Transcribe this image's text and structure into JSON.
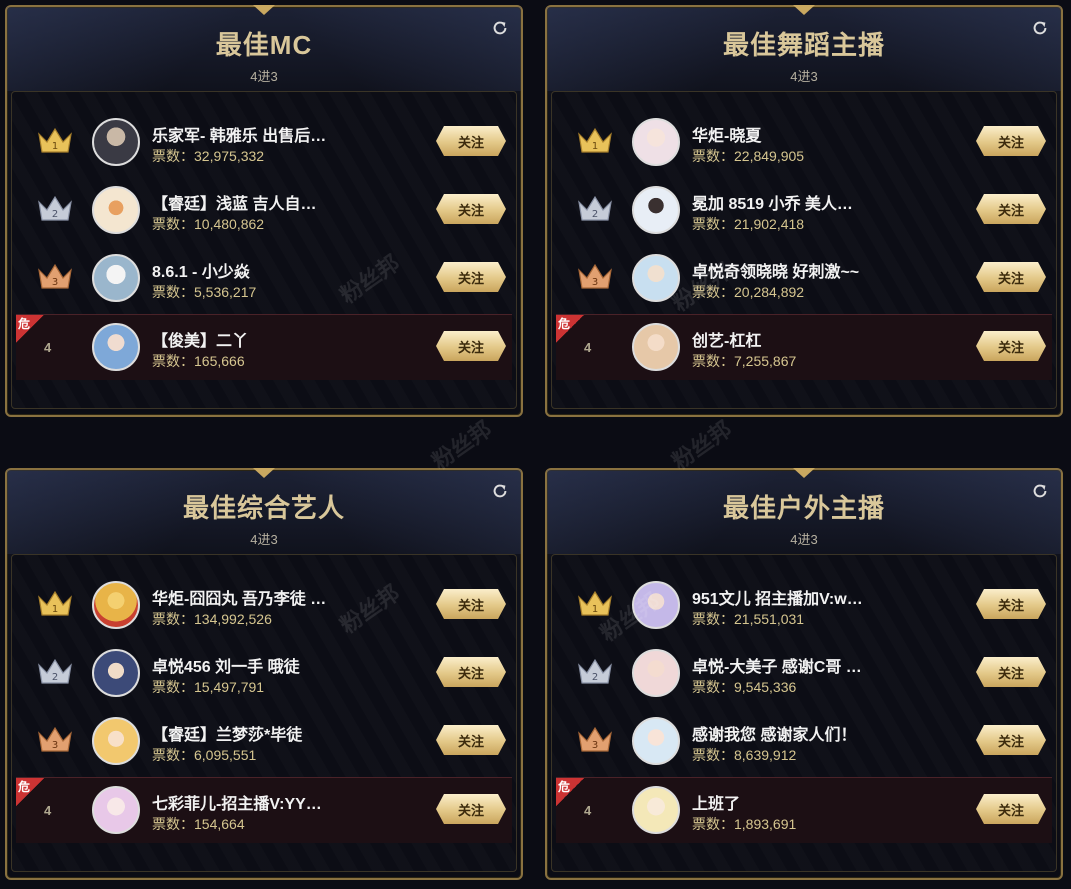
{
  "panels": [
    {
      "title": "最佳MC",
      "sub": "4进3",
      "rows": [
        {
          "rank": "1",
          "name": "乐家军- 韩雅乐 出售后…",
          "votes": "票数：32,975,332",
          "follow": "关注"
        },
        {
          "rank": "2",
          "name": "【睿廷】浅蓝 吉人自…",
          "votes": "票数：10,480,862",
          "follow": "关注"
        },
        {
          "rank": "3",
          "name": "8.6.1 - 小少焱",
          "votes": "票数：5,536,217",
          "follow": "关注"
        },
        {
          "rank": "4",
          "name": "【俊美】二丫",
          "votes": "票数：165,666",
          "follow": "关注",
          "danger": "危"
        }
      ]
    },
    {
      "title": "最佳舞蹈主播",
      "sub": "4进3",
      "rows": [
        {
          "rank": "1",
          "name": "华炬-晓夏",
          "votes": "票数：22,849,905",
          "follow": "关注"
        },
        {
          "rank": "2",
          "name": "冕加 8519 小乔 美人…",
          "votes": "票数：21,902,418",
          "follow": "关注"
        },
        {
          "rank": "3",
          "name": "卓悦奇领晓晓 好刺激~~",
          "votes": "票数：20,284,892",
          "follow": "关注"
        },
        {
          "rank": "4",
          "name": "创艺-杠杠",
          "votes": "票数：7,255,867",
          "follow": "关注",
          "danger": "危"
        }
      ]
    },
    {
      "title": "最佳综合艺人",
      "sub": "4进3",
      "rows": [
        {
          "rank": "1",
          "name": "华炬-囧囧丸 吾乃李徒 …",
          "votes": "票数：134,992,526",
          "follow": "关注"
        },
        {
          "rank": "2",
          "name": "卓悦456 刘一手 哦徒",
          "votes": "票数：15,497,791",
          "follow": "关注"
        },
        {
          "rank": "3",
          "name": "【睿廷】兰梦莎*毕徒",
          "votes": "票数：6,095,551",
          "follow": "关注"
        },
        {
          "rank": "4",
          "name": "七彩菲儿-招主播V:YY…",
          "votes": "票数：154,664",
          "follow": "关注",
          "danger": "危"
        }
      ]
    },
    {
      "title": "最佳户外主播",
      "sub": "4进3",
      "rows": [
        {
          "rank": "1",
          "name": "951文儿 招主播加V:w…",
          "votes": "票数：21,551,031",
          "follow": "关注"
        },
        {
          "rank": "2",
          "name": "卓悦-大美子 感谢C哥 …",
          "votes": "票数：9,545,336",
          "follow": "关注"
        },
        {
          "rank": "3",
          "name": "感谢我您 感谢家人们！",
          "votes": "票数：8,639,912",
          "follow": "关注"
        },
        {
          "rank": "4",
          "name": "上班了",
          "votes": "票数：1,893,691",
          "follow": "关注",
          "danger": "危"
        }
      ]
    }
  ],
  "watermark": "粉丝邦",
  "colors": {
    "gold": "#c9a860",
    "crown_gold": "#e9c25a",
    "crown_silver": "#c6ccd8",
    "crown_bronze": "#e2a070",
    "danger": "#cc3333"
  },
  "avatars": [
    "#3a3a44",
    "#f4e6d0",
    "#d7e6f2",
    "#9fc6e8",
    "#efe0e6",
    "#e8eef6",
    "#c8dff0",
    "#e6c8a8",
    "#e8b448",
    "#3c4a78",
    "#f2c86e",
    "#e8c8e8",
    "#c4b8e8",
    "#f0d8d8",
    "#d8e8f4",
    "#f4e8b8"
  ]
}
